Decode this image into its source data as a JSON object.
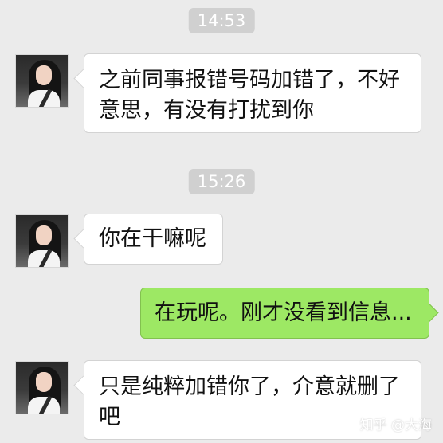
{
  "colors": {
    "background": "#ebebeb",
    "timestamp_bg": "#d0d0d0",
    "incoming_bubble": "#ffffff",
    "outgoing_bubble": "#9de864"
  },
  "timestamps": [
    "14:53",
    "15:26"
  ],
  "messages": [
    {
      "direction": "incoming",
      "text": "之前同事报错号码加错了，不好意思，有没有打扰到你",
      "avatar": "contact-avatar"
    },
    {
      "direction": "incoming",
      "text": "你在干嘛呢",
      "avatar": "contact-avatar"
    },
    {
      "direction": "outgoing",
      "text": "在玩呢。刚才没看到信息..."
    },
    {
      "direction": "incoming",
      "text": "只是纯粹加错你了，介意就删了吧",
      "avatar": "contact-avatar"
    }
  ],
  "watermark": "知乎 @大海"
}
